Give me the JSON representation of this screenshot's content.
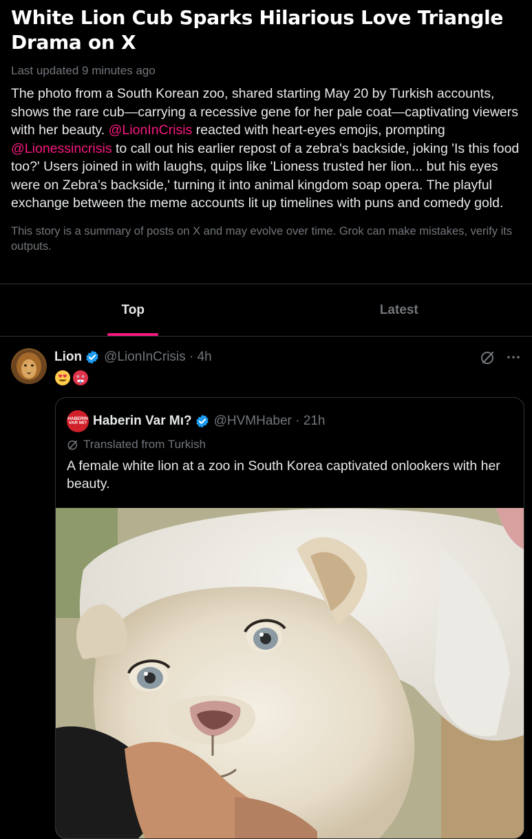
{
  "story": {
    "title": "White Lion Cub Sparks Hilarious Love Triangle Drama on X",
    "updated": "Last updated 9 minutes ago",
    "summary_part1": "The photo from a South Korean zoo, shared starting May 20 by Turkish accounts, shows the rare cub—carrying a recessive gene for her pale coat—captivating viewers with her beauty. ",
    "mention1": "@LionInCrisis",
    "summary_part2": " reacted with heart-eyes emojis, prompting ",
    "mention2": "@Lionessincrisis",
    "summary_part3": " to call out his earlier repost of a zebra's backside, joking 'Is this food too?' Users joined in with laughs, quips like 'Lioness trusted her lion... but his eyes were on Zebra’s backside,' turning it into animal kingdom soap opera. The playful exchange between the meme accounts lit up timelines with puns and comedy gold.",
    "disclaimer": "This story is a summary of posts on X and may evolve over time. Grok can make mistakes, verify its outputs."
  },
  "tabs": [
    {
      "label": "Top",
      "active": true
    },
    {
      "label": "Latest",
      "active": false
    }
  ],
  "post": {
    "author_name": "Lion",
    "handle_time": "@LionInCrisis · 4h",
    "emojis": [
      "heart-eyes-emoji",
      "hot-face-emoji"
    ],
    "icons": [
      "grok-icon",
      "more-icon"
    ],
    "quote": {
      "avatar_text": "HABERIN VAR MI?",
      "author_name": "Haberin Var Mı?",
      "handle_time": "@HVMHaber · 21h",
      "translated": "Translated from Turkish",
      "text": "A female white lion at a zoo in South Korea captivated onlookers with her beauty."
    }
  },
  "colors": {
    "background": "#000000",
    "accent": "#f91880",
    "muted": "#71767b",
    "verified": "#1d9bf0"
  }
}
